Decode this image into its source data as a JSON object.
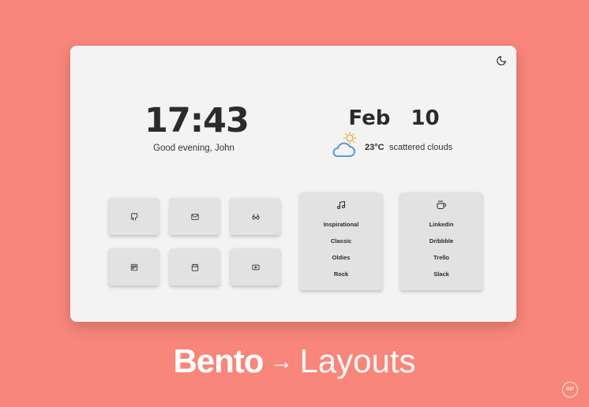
{
  "clock": {
    "time": "17:43",
    "greeting": "Good evening, John"
  },
  "date": {
    "text": "Feb  10"
  },
  "weather": {
    "temperature": "23°C",
    "description": "scattered clouds",
    "icon": "partly-cloudy-icon"
  },
  "theme_toggle": {
    "icon": "moon-icon"
  },
  "quick_links": [
    {
      "icon": "github-icon"
    },
    {
      "icon": "mail-icon"
    },
    {
      "icon": "glasses-icon"
    },
    {
      "icon": "trello-icon"
    },
    {
      "icon": "calendar-icon"
    },
    {
      "icon": "youtube-icon"
    }
  ],
  "music_list": {
    "icon": "music-note-icon",
    "items": [
      "Inspirational",
      "Classic",
      "Oldies",
      "Rock"
    ]
  },
  "coffee_list": {
    "icon": "coffee-icon",
    "items": [
      "Linkedin",
      "Dribbble",
      "Trello",
      "Slack"
    ]
  },
  "footer": {
    "bold": "Bento",
    "arrow": "→",
    "thin": "Layouts"
  },
  "badge": {
    "label": "GIF"
  },
  "colors": {
    "background": "#f8867a",
    "card": "#f3f3f3",
    "tile": "#e2e2e2",
    "text": "#2b2b2b",
    "sun": "#f0a030",
    "cloud": "#5b9bd5"
  }
}
